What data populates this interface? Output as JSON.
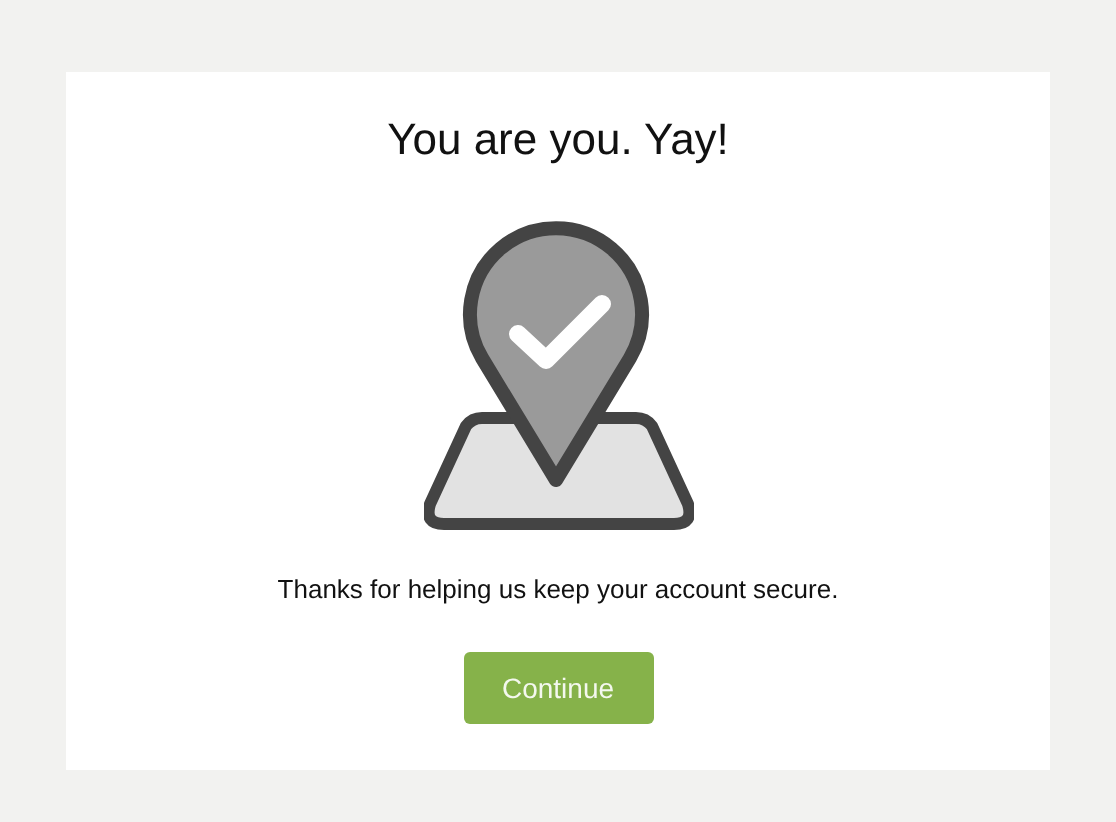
{
  "title": "You are you. Yay!",
  "message": "Thanks for helping us keep your account secure.",
  "button": {
    "label": "Continue"
  }
}
